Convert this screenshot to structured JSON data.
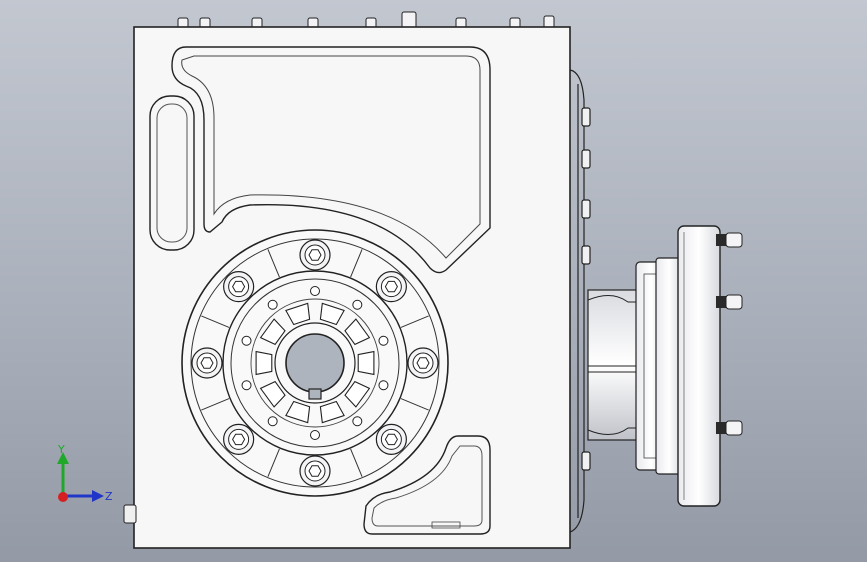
{
  "viewport": {
    "background_top": "#c2c7d0",
    "background_bottom": "#939aa6"
  },
  "colors": {
    "body_fill": "#f7f7f8",
    "edge": "#222222",
    "x_axis": "#d42020",
    "y_axis": "#1fa82a",
    "z_axis": "#2036c8"
  },
  "triad": {
    "y_label": "Y",
    "z_label": "Z"
  }
}
